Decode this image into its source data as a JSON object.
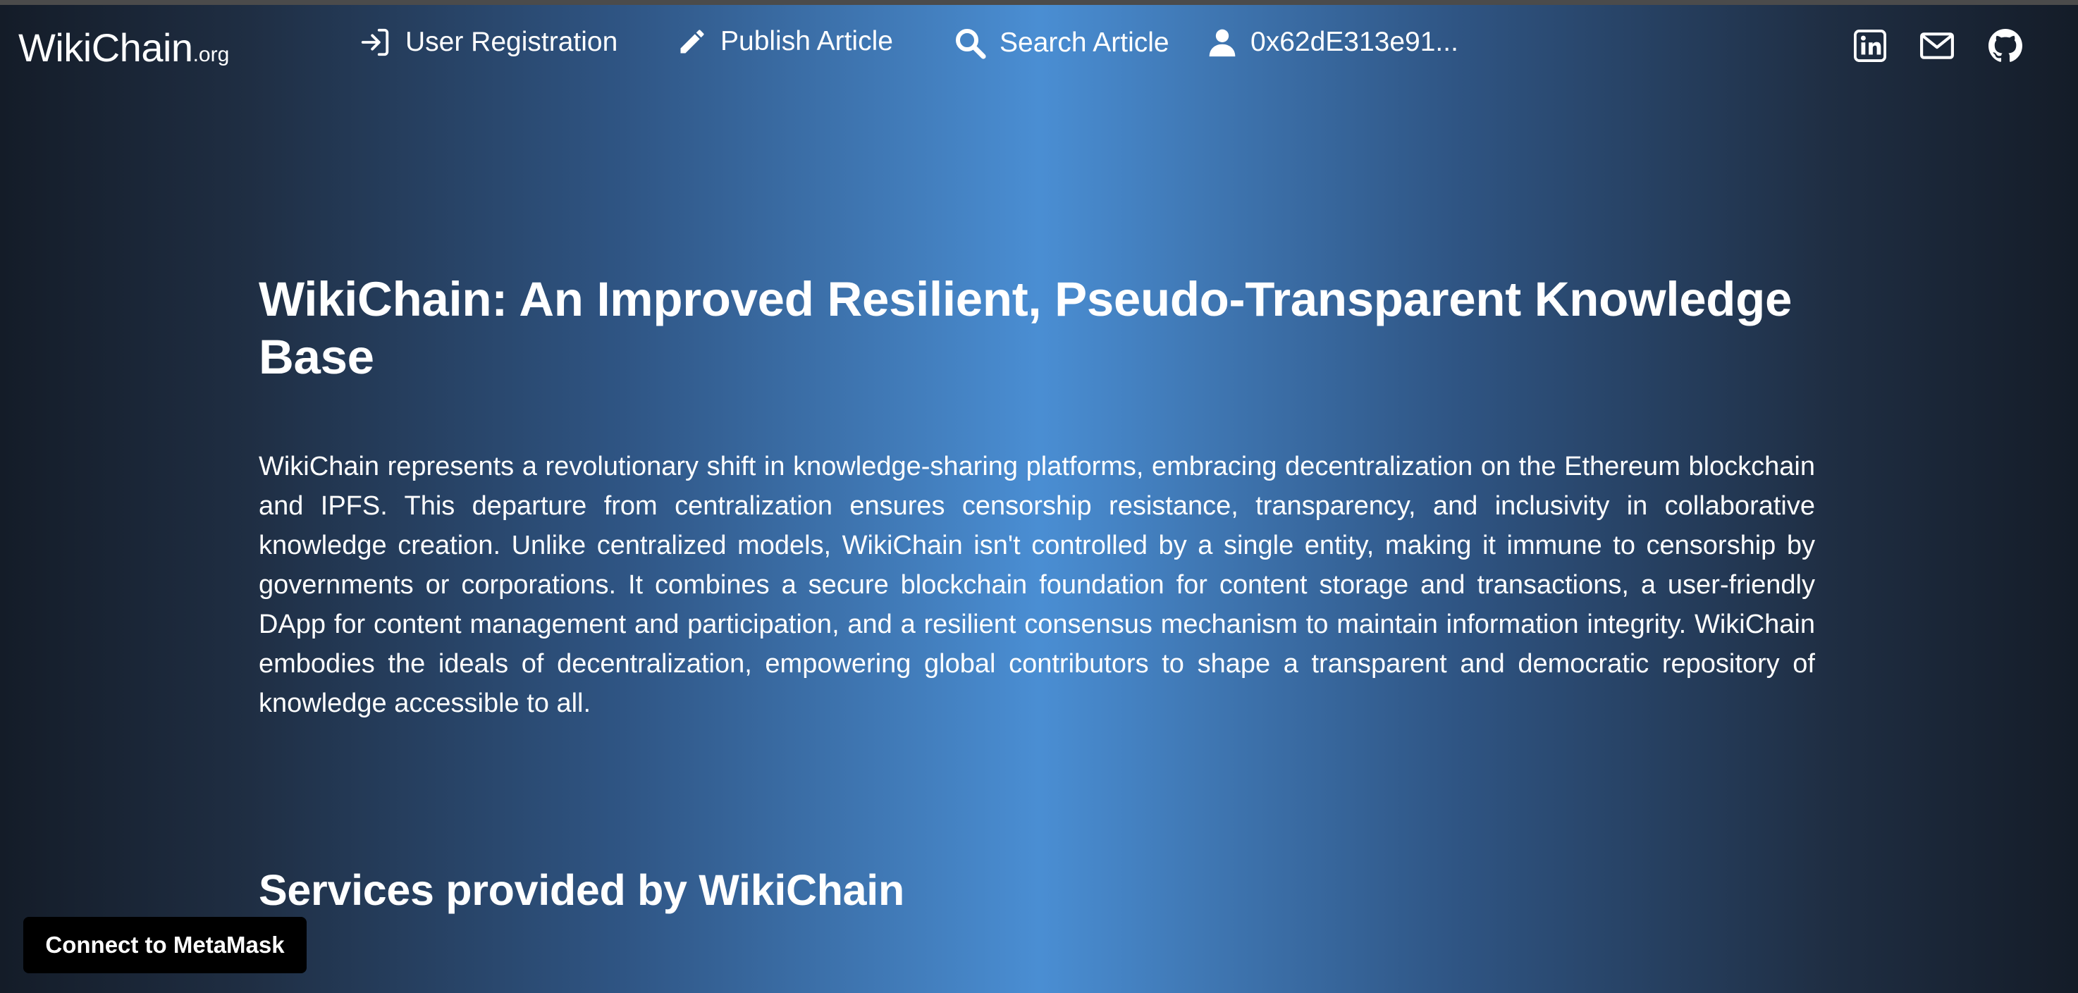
{
  "header": {
    "brand_name": "WikiChain",
    "brand_tld": ".org",
    "nav": {
      "register_label": "User Registration",
      "publish_label": "Publish Article",
      "search_label": "Search Article",
      "account_label": "0x62dE313e91..."
    },
    "social_icons": [
      "linkedin-icon",
      "mail-icon",
      "github-icon"
    ]
  },
  "main": {
    "title": "WikiChain: An Improved Resilient, Pseudo-Transparent Knowledge Base",
    "intro": "WikiChain represents a revolutionary shift in knowledge-sharing platforms, embracing decentralization on the Ethereum blockchain and IPFS. This departure from centralization ensures censorship resistance, transparency, and inclusivity in collaborative knowledge creation. Unlike centralized models, WikiChain isn't controlled by a single entity, making it immune to censorship by governments or corporations. It combines a secure blockchain foundation for content storage and transactions, a user-friendly DApp for content management and participation, and a resilient consensus mechanism to maintain information integrity. WikiChain embodies the ideals of decentralization, empowering global contributors to shape a transparent and democratic repository of knowledge accessible to all.",
    "services_heading": "Services provided by WikiChain"
  },
  "metamask_button_label": "Connect to MetaMask",
  "colors": {
    "background_edge": "#141c28",
    "background_center": "#4a8ed3",
    "text": "#ffffff",
    "button_bg": "#000000"
  }
}
